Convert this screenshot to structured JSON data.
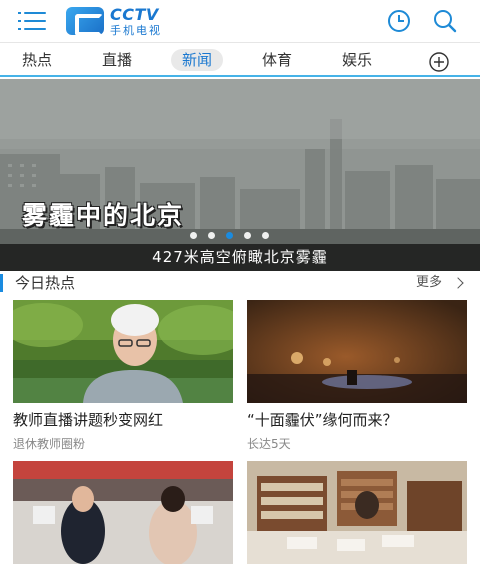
{
  "header": {
    "logo_en": "CCTV",
    "logo_cn": "手机电视",
    "menu_icon": "menu-icon",
    "history_icon": "history-clock-icon",
    "search_icon": "search-icon",
    "accent": "#1a8be0"
  },
  "tabs": [
    {
      "label": "热点"
    },
    {
      "label": "直播"
    },
    {
      "label": "新闻",
      "active": true
    },
    {
      "label": "体育"
    },
    {
      "label": "娱乐"
    }
  ],
  "add_tab_icon": "plus-circle-icon",
  "hero": {
    "overlay_title": "雾霾中的北京",
    "caption": "427米高空俯瞰北京雾霾",
    "slide_count": 5,
    "active_slide": 3
  },
  "section": {
    "title": "今日热点",
    "more": "更多"
  },
  "cards": [
    {
      "title": "教师直播讲题秒变网红",
      "subtitle": "退休教师圈粉"
    },
    {
      "title": "“十面霾伏”缘何而来？",
      "subtitle": "长达5天"
    },
    {
      "title": "",
      "subtitle": ""
    },
    {
      "title": "",
      "subtitle": ""
    }
  ]
}
